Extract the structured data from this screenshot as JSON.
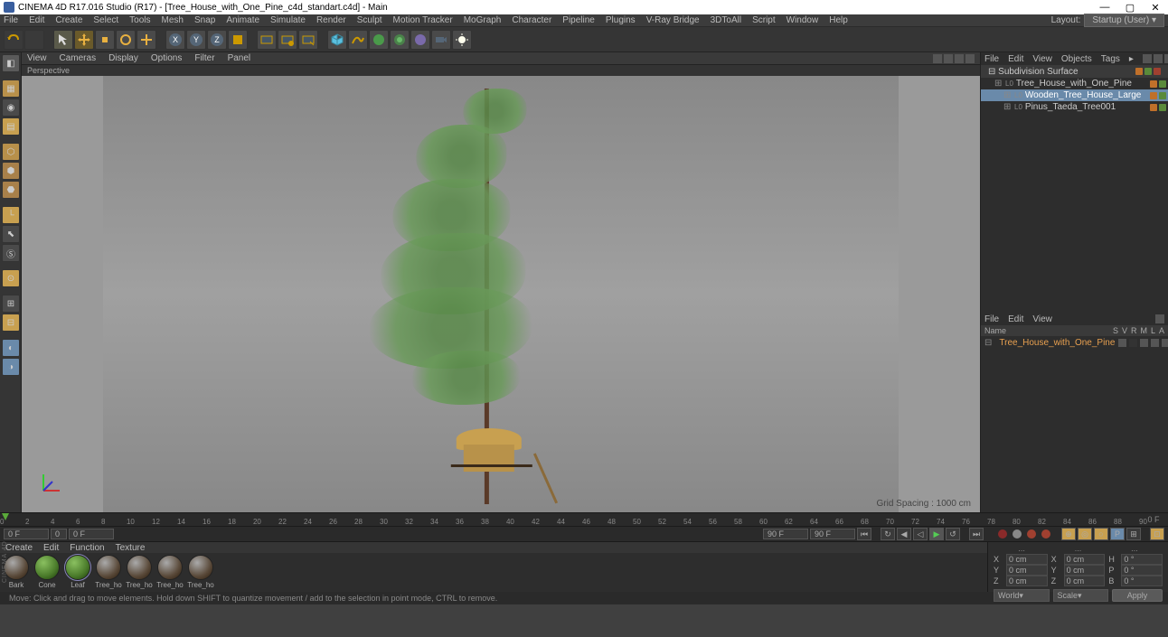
{
  "title": "CINEMA 4D R17.016 Studio (R17) - [Tree_House_with_One_Pine_c4d_standart.c4d] - Main",
  "menubar": [
    "File",
    "Edit",
    "Create",
    "Select",
    "Tools",
    "Mesh",
    "Snap",
    "Animate",
    "Simulate",
    "Render",
    "Sculpt",
    "Motion Tracker",
    "MoGraph",
    "Character",
    "Pipeline",
    "Plugins",
    "V-Ray Bridge",
    "3DToAll",
    "Script",
    "Window",
    "Help"
  ],
  "layout_label": "Layout:",
  "layout_value": "Startup (User)",
  "viewport_menu": [
    "View",
    "Cameras",
    "Display",
    "Options",
    "Filter",
    "Panel"
  ],
  "viewport_label": "Perspective",
  "grid_spacing": "Grid Spacing : 1000 cm",
  "timeline": {
    "start": 0,
    "end": 90,
    "end_label": "0 F"
  },
  "playback": {
    "cur_frame": "0 F",
    "spin": "0",
    "in_frame": "0 F",
    "out_frame_l": "90 F",
    "out_frame_r": "90 F"
  },
  "object_panel": {
    "tabs": [
      "File",
      "Edit",
      "View",
      "Objects",
      "Tags"
    ],
    "root": {
      "name": "Subdivision Surface"
    },
    "items": [
      {
        "indent": 1,
        "type": "L0",
        "name": "Tree_House_with_One_Pine"
      },
      {
        "indent": 2,
        "type": "L0",
        "name": "Wooden_Tree_House_Large",
        "highlight": true
      },
      {
        "indent": 2,
        "type": "L0",
        "name": "Pinus_Taeda_Tree001"
      }
    ]
  },
  "attr_panel": {
    "tabs": [
      "File",
      "Edit",
      "View"
    ],
    "cols_label": "Name",
    "cols_right": [
      "S",
      "V",
      "R",
      "M",
      "L",
      "A"
    ],
    "item": "Tree_House_with_One_Pine"
  },
  "material_tabs": [
    "Create",
    "Edit",
    "Function",
    "Texture"
  ],
  "materials": [
    {
      "name": "Bark",
      "color": "brown"
    },
    {
      "name": "Cone",
      "color": "green"
    },
    {
      "name": "Leaf",
      "color": "green",
      "selected": true
    },
    {
      "name": "Tree_ho",
      "color": "brown"
    },
    {
      "name": "Tree_ho",
      "color": "brown"
    },
    {
      "name": "Tree_ho",
      "color": "brown"
    },
    {
      "name": "Tree_ho",
      "color": "brown"
    }
  ],
  "coords": {
    "hdr": [
      "...",
      "...",
      "..."
    ],
    "rows": [
      {
        "a": "X",
        "av": "0 cm",
        "b": "X",
        "bv": "0 cm",
        "c": "H",
        "cv": "0 °"
      },
      {
        "a": "Y",
        "av": "0 cm",
        "b": "Y",
        "bv": "0 cm",
        "c": "P",
        "cv": "0 °"
      },
      {
        "a": "Z",
        "av": "0 cm",
        "b": "Z",
        "bv": "0 cm",
        "c": "B",
        "cv": "0 °"
      }
    ],
    "dd1": "World",
    "dd2": "Scale",
    "apply": "Apply"
  },
  "logo": "CINEMA 4D",
  "status": "Move: Click and drag to move elements. Hold down SHIFT to quantize movement / add to the selection in point mode, CTRL to remove."
}
